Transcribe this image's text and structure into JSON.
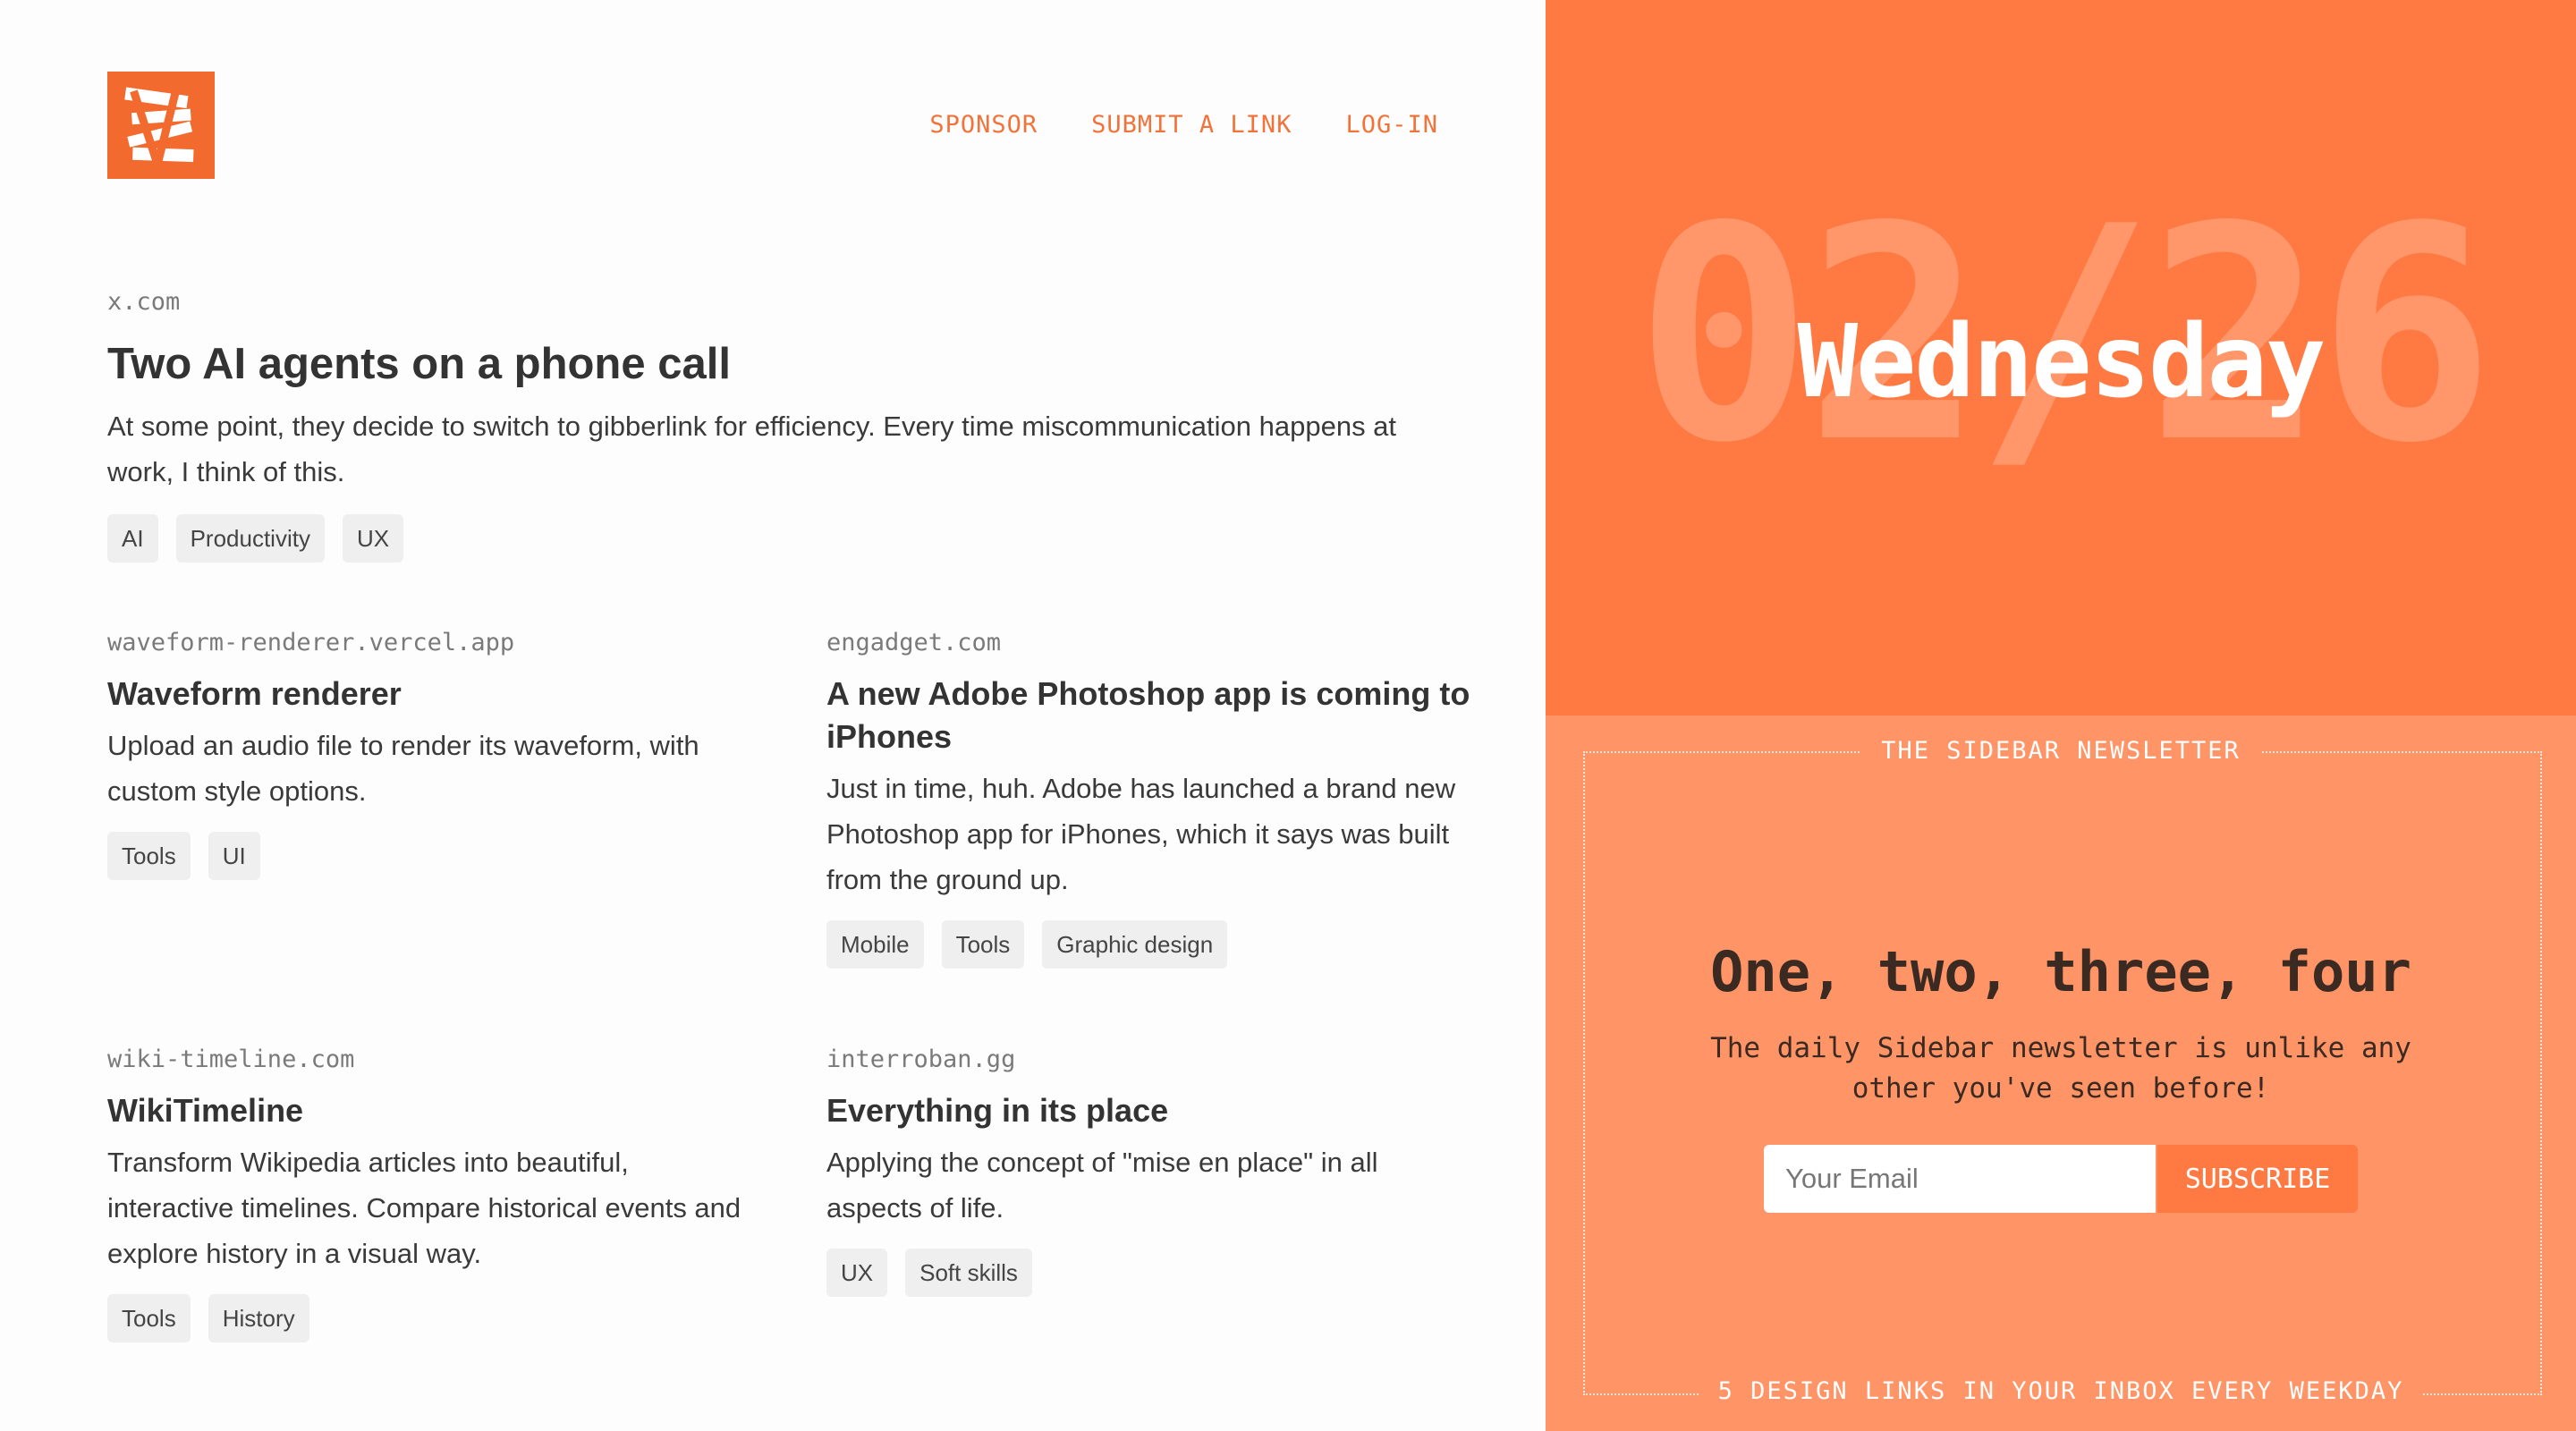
{
  "nav": {
    "sponsor": "SPONSOR",
    "submit": "SUBMIT A LINK",
    "login": "LOG-IN"
  },
  "articles": [
    {
      "domain": "x.com",
      "title": "Two AI agents on a phone call",
      "desc": "At some point, they decide to switch to gibberlink for efficiency. Every time miscommunication happens at work, I think of this.",
      "tags": [
        "AI",
        "Productivity",
        "UX"
      ]
    },
    {
      "domain": "waveform-renderer.vercel.app",
      "title": "Waveform renderer",
      "desc": "Upload an audio file to render its waveform, with custom style options.",
      "tags": [
        "Tools",
        "UI"
      ]
    },
    {
      "domain": "engadget.com",
      "title": "A new Adobe Photoshop app is coming to iPhones",
      "desc": "Just in time, huh. Adobe has launched a brand new Photoshop app for iPhones, which it says was built from the ground up.",
      "tags": [
        "Mobile",
        "Tools",
        "Graphic design"
      ]
    },
    {
      "domain": "wiki-timeline.com",
      "title": "WikiTimeline",
      "desc": "Transform Wikipedia articles into beautiful, interactive timelines. Compare historical events and explore history in a visual way.",
      "tags": [
        "Tools",
        "History"
      ]
    },
    {
      "domain": "interroban.gg",
      "title": "Everything in its place",
      "desc": "Applying the concept of \"mise en place\" in all aspects of life.",
      "tags": [
        "UX",
        "Soft skills"
      ]
    }
  ],
  "hero": {
    "date": "02/26",
    "day": "Wednesday"
  },
  "newsletter": {
    "label": "THE SIDEBAR NEWSLETTER",
    "title": "One, two, three, four",
    "desc": "The daily Sidebar newsletter is unlike any other you've seen before!",
    "email_placeholder": "Your Email",
    "subscribe": "SUBSCRIBE",
    "footer": "5 DESIGN LINKS IN YOUR INBOX EVERY WEEKDAY"
  },
  "colors": {
    "accent": "#ff7a42",
    "panel": "#ff9467",
    "link": "#f2733a"
  },
  "icons": {
    "logo": "sidebar-logo-icon"
  }
}
